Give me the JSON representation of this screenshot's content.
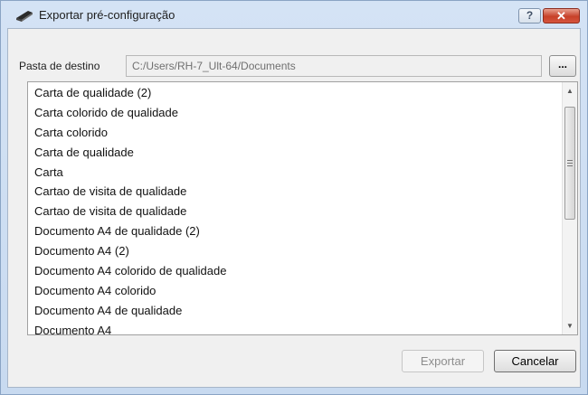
{
  "window": {
    "title": "Exportar pré-configuração",
    "help_label": "?",
    "close_label": "✕"
  },
  "destination": {
    "label": "Pasta de destino",
    "path": "C:/Users/RH-7_Ult-64/Documents",
    "browse_label": "..."
  },
  "presets": [
    "Carta de qualidade (2)",
    "Carta colorido de qualidade",
    "Carta colorido",
    "Carta de qualidade",
    "Carta",
    "Cartao de visita de qualidade",
    "Cartao de visita de qualidade",
    "Documento A4 de qualidade (2)",
    "Documento A4 (2)",
    "Documento A4 colorido de qualidade",
    "Documento A4 colorido",
    "Documento A4 de qualidade",
    "Documento A4"
  ],
  "buttons": {
    "export_label": "Exportar",
    "cancel_label": "Cancelar"
  },
  "icons": {
    "title_icon": "scanner-icon",
    "scroll_up": "scroll-up-arrow-icon",
    "scroll_down": "scroll-down-arrow-icon"
  }
}
